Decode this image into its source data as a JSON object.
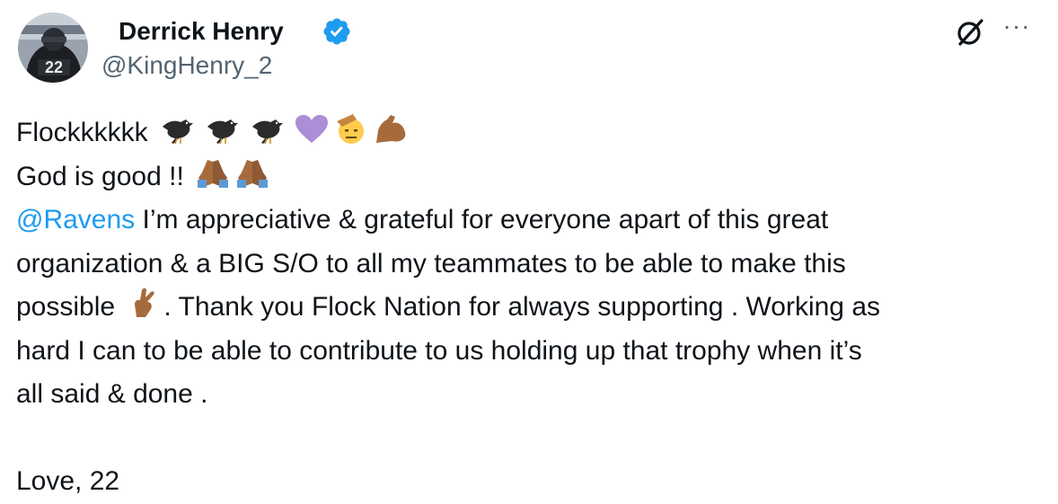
{
  "tweet": {
    "author_name": "Derrick Henry",
    "handle": "@KingHenry_2",
    "avatar_jersey": "22",
    "more_label": "···",
    "line1_text": "Flockkkkkk",
    "line2_text": "God is good !!",
    "mention": "@Ravens",
    "line3_rest": " I’m appreciative & grateful for everyone apart of this great",
    "line4": "organization & a BIG S/O to all my teammates to be able to make this",
    "line5_a": "possible ",
    "line5_b": ". Thank you Flock Nation for always supporting . Working as",
    "line6": "hard I can to be able to contribute to us holding up that trophy when it’s",
    "line7": "all said & done .",
    "signoff": "Love, 22"
  },
  "icons": {
    "verified": "verified-badge-icon",
    "grok": "grok-icon",
    "more": "more-icon"
  },
  "colors": {
    "text": "#0f1419",
    "secondary": "#536471",
    "link": "#1d9bf0",
    "verified": "#1d9bf0"
  }
}
